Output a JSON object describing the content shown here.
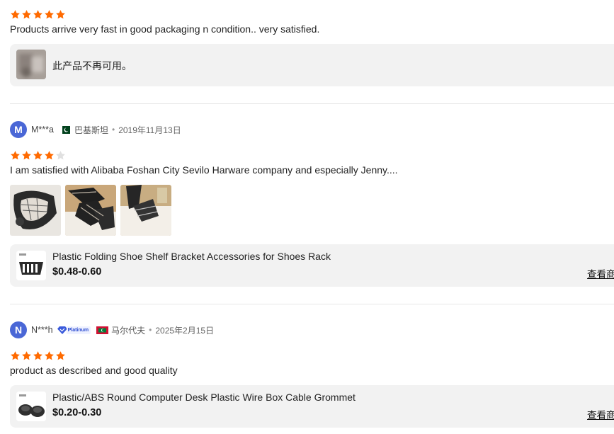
{
  "colors": {
    "star_filled": "#ff6a00",
    "star_empty": "#e0e0e0",
    "avatar": "#4a67d6",
    "card_bg": "#f2f2f2",
    "platinum_badge": "#2b4bd1"
  },
  "reviews": [
    {
      "rating": 5,
      "text": "Products arrive very fast in good packaging n condition.. very satisfied.",
      "product": {
        "title": "此产品不再可用。",
        "image_icon": "blurred-product-thumbnail"
      }
    },
    {
      "avatar_letter": "M",
      "username": "M***a",
      "country_flag_icon": "pakistan-flag-icon",
      "country": "巴基斯坦",
      "date": "2019年11月13日",
      "rating": 4,
      "text": "I am satisfied with Alibaba Foshan City Sevilo Harware company and especially Jenny....",
      "photos": [
        "review-photo-1",
        "review-photo-2",
        "review-photo-3"
      ],
      "product": {
        "title": "Plastic Folding Shoe Shelf Bracket Accessories for Shoes Rack",
        "price": "$0.48-0.60",
        "link": "查看商"
      }
    },
    {
      "avatar_letter": "N",
      "username": "N***h",
      "badge": "Platinum",
      "country_flag_icon": "maldives-flag-icon",
      "country": "马尔代夫",
      "date": "2025年2月15日",
      "rating": 5,
      "text": "product as described and good quality",
      "product": {
        "title": "Plastic/ABS Round Computer Desk Plastic Wire Box Cable Grommet",
        "price": "$0.20-0.30",
        "link": "查看商"
      }
    }
  ],
  "separator": "•"
}
